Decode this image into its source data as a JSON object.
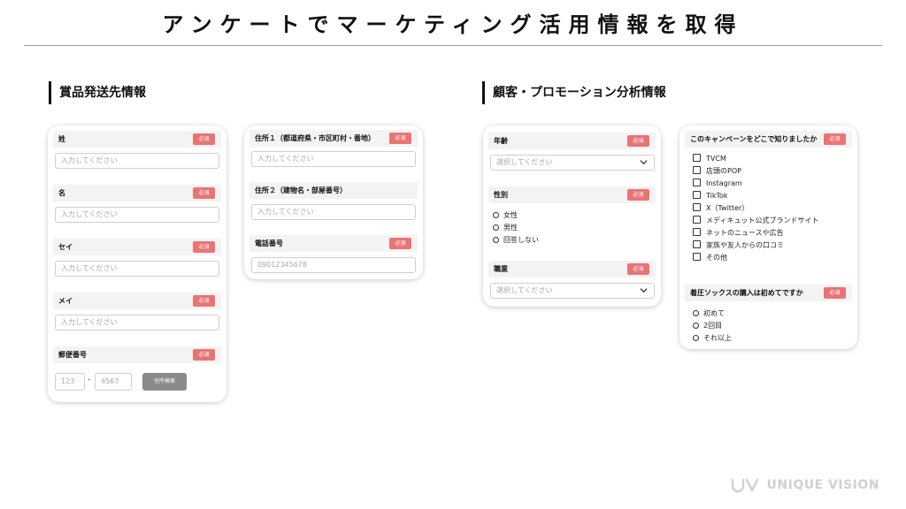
{
  "page": {
    "title": "アンケートでマーケティング活用情報を取得"
  },
  "left_section": {
    "heading": "賞品発送先情報",
    "card1": {
      "fields": [
        {
          "label": "姓",
          "required": "必須",
          "placeholder": "入力してください"
        },
        {
          "label": "名",
          "required": "必須",
          "placeholder": "入力してください"
        },
        {
          "label": "セイ",
          "required": "必須",
          "placeholder": "入力してください"
        },
        {
          "label": "メイ",
          "required": "必須",
          "placeholder": "入力してください"
        }
      ],
      "postal": {
        "label": "郵便番号",
        "required": "必須",
        "first_placeholder": "123",
        "dash": "-",
        "second_placeholder": "4567",
        "search_button": "住所検索"
      }
    },
    "card2": {
      "address1": {
        "label": "住所１（都道府県・市区町村・番地）",
        "required": "必須",
        "placeholder": "入力してください"
      },
      "address2": {
        "label": "住所２（建物名・部屋番号）",
        "placeholder": "入力してください"
      },
      "phone": {
        "label": "電話番号",
        "required": "必須",
        "placeholder": "09012345678"
      }
    }
  },
  "right_section": {
    "heading": "顧客・プロモーション分析情報",
    "card1": {
      "age": {
        "label": "年齢",
        "required": "必須",
        "placeholder": "選択してください"
      },
      "gender": {
        "label": "性別",
        "required": "必須",
        "options": [
          "女性",
          "男性",
          "回答しない"
        ]
      },
      "job": {
        "label": "職業",
        "required": "必須",
        "placeholder": "選択してください"
      }
    },
    "card2": {
      "source": {
        "label": "このキャンペーンをどこで知りましたか",
        "required": "必須",
        "options": [
          "TVCM",
          "店頭のPOP",
          "Instagram",
          "TikTok",
          "X（Twitter）",
          "メディキュット公式ブランドサイト",
          "ネットのニュースや広告",
          "家族や友人からの口コミ",
          "その他"
        ]
      },
      "first_purchase": {
        "label": "着圧ソックスの購入は初めてですか",
        "required": "必須",
        "options": [
          "初めて",
          "2回目",
          "それ以上"
        ]
      }
    }
  },
  "footer": {
    "logo_text": "UNIQUE VISION"
  },
  "colors": {
    "required_badge": "#ea7474",
    "section_bar": "#111111",
    "field_header_bg": "#f3f3f3"
  }
}
